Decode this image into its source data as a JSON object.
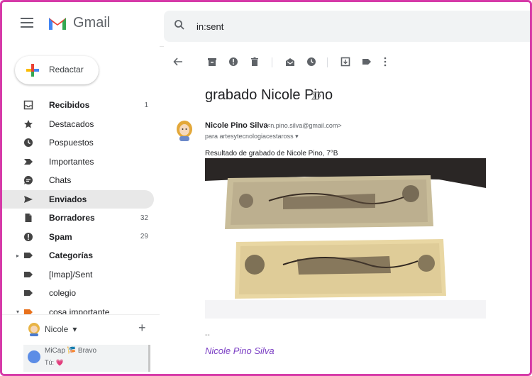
{
  "header": {
    "app_name": "Gmail",
    "search_value": "in:sent"
  },
  "sidebar": {
    "compose_label": "Redactar",
    "items": [
      {
        "label": "Recibidos",
        "count": "1",
        "bold": true,
        "icon": "inbox-icon"
      },
      {
        "label": "Destacados",
        "count": "",
        "bold": false,
        "icon": "star-icon"
      },
      {
        "label": "Pospuestos",
        "count": "",
        "bold": false,
        "icon": "clock-icon"
      },
      {
        "label": "Importantes",
        "count": "",
        "bold": false,
        "icon": "important-icon"
      },
      {
        "label": "Chats",
        "count": "",
        "bold": false,
        "icon": "chat-icon"
      },
      {
        "label": "Enviados",
        "count": "",
        "bold": true,
        "icon": "send-icon"
      },
      {
        "label": "Borradores",
        "count": "32",
        "bold": true,
        "icon": "draft-icon"
      },
      {
        "label": "Spam",
        "count": "29",
        "bold": true,
        "icon": "spam-icon"
      },
      {
        "label": "Categorías",
        "count": "",
        "bold": true,
        "icon": "label-icon"
      },
      {
        "label": "[Imap]/Sent",
        "count": "",
        "bold": false,
        "icon": "label-icon"
      },
      {
        "label": "colegio",
        "count": "",
        "bold": false,
        "icon": "label-icon"
      },
      {
        "label": "cosa importante",
        "count": "",
        "bold": false,
        "icon": "label-icon"
      }
    ]
  },
  "hangouts": {
    "user_name": "Nicole",
    "user_caret": "▾",
    "chat_name": "MiCap 🎏 Bravo",
    "chat_preview": "Tú: 💗"
  },
  "message": {
    "subject": "grabado Nicole Pino",
    "sender_name": "Nicole Pino Silva",
    "sender_email": "<n.pino.silva@gmail.com>",
    "recipient": "para artesytecnologiacestaross ▾",
    "body": "Resultado de grabado de Nicole Pino, 7°B",
    "signature_separator": "--",
    "signature": "Nicole Pino Silva"
  },
  "colors": {
    "frame": "#d63aa8",
    "signature": "#7b3fc4",
    "gmail_red": "#ea4335"
  }
}
